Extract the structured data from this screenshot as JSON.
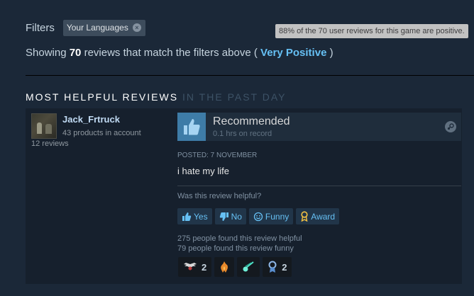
{
  "filters": {
    "label": "Filters",
    "chip_label": "Your Languages",
    "chip_remove_glyph": "×"
  },
  "tooltip": "88% of the 70 user reviews for this game are positive.",
  "summary": {
    "prefix": "Showing ",
    "count": "70",
    "middle": " reviews that match the filters above ( ",
    "rating": "Very Positive",
    "suffix": " )"
  },
  "section": {
    "title": "MOST HELPFUL REVIEWS",
    "subtitle": "IN THE PAST DAY"
  },
  "review": {
    "author_name": "Jack_Frtruck",
    "author_products": "43 products in account",
    "author_reviews": "12 reviews",
    "verdict": "Recommended",
    "hours": "0.1 hrs on record",
    "posted": "POSTED: 7 NOVEMBER",
    "text": "i hate my life",
    "helpful_question": "Was this review helpful?",
    "buttons": {
      "yes": "Yes",
      "no": "No",
      "funny": "Funny",
      "award": "Award"
    },
    "helpful_count_text": "275 people found this review helpful",
    "funny_count_text": "79 people found this review funny",
    "awards": [
      {
        "icon": "winged-award-icon",
        "count": "2"
      },
      {
        "icon": "fire-award-icon",
        "count": ""
      },
      {
        "icon": "comet-award-icon",
        "count": ""
      },
      {
        "icon": "ribbon-award-icon",
        "count": "2"
      }
    ]
  },
  "colors": {
    "background": "#1b2838",
    "accent": "#66c0f4",
    "card": "#16202d",
    "thumb_box": "#3e7ca7"
  }
}
